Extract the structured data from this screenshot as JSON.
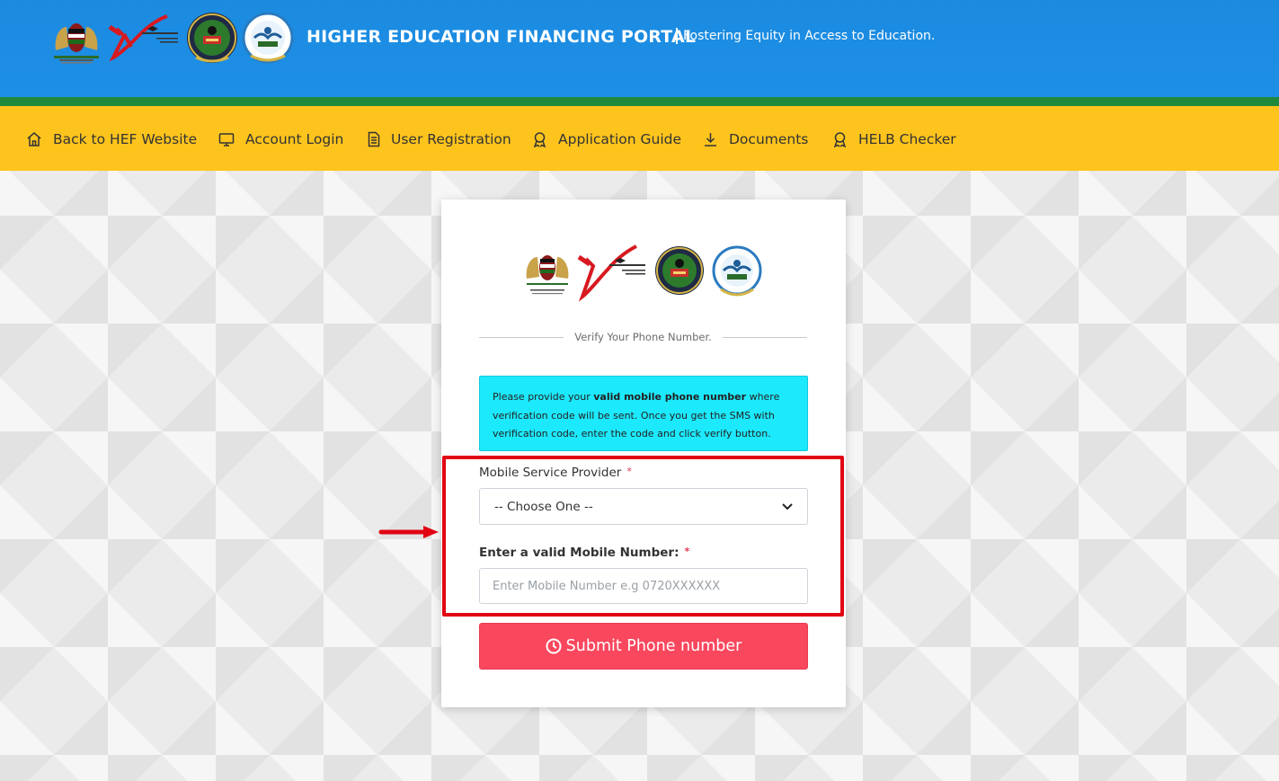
{
  "header": {
    "title": "HIGHER EDUCATION FINANCING PORTAL",
    "tagline": "Fostering Equity in Access to Education."
  },
  "nav": {
    "items": [
      {
        "label": "Back to HEF Website",
        "icon": "home-icon"
      },
      {
        "label": "Account Login",
        "icon": "monitor-icon"
      },
      {
        "label": "User Registration",
        "icon": "document-icon"
      },
      {
        "label": "Application Guide",
        "icon": "award-icon"
      },
      {
        "label": "Documents",
        "icon": "download-icon"
      },
      {
        "label": "HELB Checker",
        "icon": "award-icon"
      }
    ]
  },
  "card": {
    "heading": "Verify Your Phone Number.",
    "info": {
      "prefix": "Please provide your ",
      "bold": "valid mobile phone number",
      "suffix": " where verification code will be sent. Once you get the SMS with verification code, enter the code and click verify button."
    },
    "provider_label": "Mobile Service Provider",
    "provider_selected": "-- Choose One --",
    "required_mark": "*",
    "mobile_label": "Enter a valid Mobile Number:",
    "mobile_placeholder": "Enter Mobile Number e.g 0720XXXXXX",
    "submit_label": "Submit Phone number"
  },
  "colors": {
    "header_blue": "#1e8fe6",
    "nav_yellow": "#fdc41e",
    "green_strip": "#1f8a3c",
    "info_cyan": "#1de9fc",
    "submit_red": "#f9475e",
    "highlight_red": "#e10514"
  }
}
